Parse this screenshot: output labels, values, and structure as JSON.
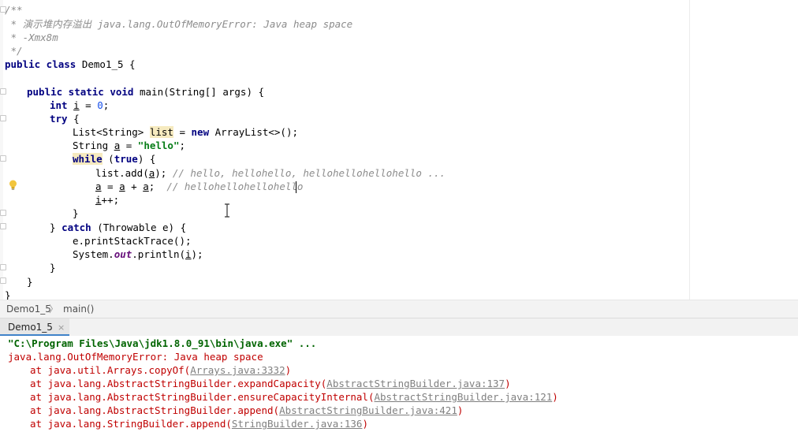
{
  "editor": {
    "lines": [
      {
        "text": "/**"
      },
      {
        "text": " * 演示堆内存溢出 java.lang.OutOfMemoryError: Java heap space"
      },
      {
        "text": " * -Xmx8m"
      },
      {
        "text": " */"
      },
      {
        "kw1": "public class",
        "rest": " Demo1_5 {"
      },
      {
        "kw1": "public static void",
        "rest": " main(String[] args) {"
      },
      {
        "kw1": "int",
        "var": "i",
        "rest": " = ",
        "num": "0",
        "end": ";"
      },
      {
        "kw1": "try",
        "rest": " {"
      },
      {
        "pre": "List<String> ",
        "hl": "list",
        "rest": " = ",
        "kw2": "new",
        "end": " ArrayList<>();"
      },
      {
        "pre": "String ",
        "var": "a",
        "rest": " = ",
        "str": "\"hello\"",
        "end": ";"
      },
      {
        "kw1": "while",
        "rest": " (",
        "kw2": "true",
        "end": ") {"
      },
      {
        "pre": "list.add(",
        "var": "a",
        "rest": "); ",
        "cmt": "// hello, hellohello, hellohellohellohello ..."
      },
      {
        "var": "a",
        "rest": " = ",
        "var2": "a",
        "mid": " + ",
        "var3": "a",
        "end": ";  ",
        "cmt": "// hellohellohellohello"
      },
      {
        "var": "i",
        "rest": "++;"
      },
      {
        "rest": "}"
      },
      {
        "pre": "} ",
        "kw1": "catch",
        "rest": " (Throwable e) {"
      },
      {
        "rest": "e.printStackTrace();"
      },
      {
        "pre": "System.",
        "static": "out",
        "mid": ".println(",
        "var": "i",
        "end": ");"
      },
      {
        "rest": "}"
      },
      {
        "rest": "}"
      },
      {
        "rest": "}"
      }
    ]
  },
  "breadcrumb": {
    "class_name": "Demo1_5",
    "separator": "〉",
    "method_name": "main()"
  },
  "run_panel": {
    "tab_label": "Demo1_5",
    "close_glyph": "×",
    "console": {
      "command": "\"C:\\Program Files\\Java\\jdk1.8.0_91\\bin\\java.exe\" ...",
      "error": "java.lang.OutOfMemoryError: Java heap space",
      "stack": [
        {
          "prefix": "at java.util.Arrays.copyOf(",
          "link": "Arrays.java:3332",
          "suffix": ")"
        },
        {
          "prefix": "at java.lang.AbstractStringBuilder.expandCapacity(",
          "link": "AbstractStringBuilder.java:137",
          "suffix": ")"
        },
        {
          "prefix": "at java.lang.AbstractStringBuilder.ensureCapacityInternal(",
          "link": "AbstractStringBuilder.java:121",
          "suffix": ")"
        },
        {
          "prefix": "at java.lang.AbstractStringBuilder.append(",
          "link": "AbstractStringBuilder.java:421",
          "suffix": ")"
        },
        {
          "prefix": "at java.lang.StringBuilder.append(",
          "link": "StringBuilder.java:136",
          "suffix": ")"
        }
      ]
    }
  },
  "colors": {
    "keyword": "#000080",
    "string": "#067d17",
    "comment": "#8c8c8c",
    "error": "#c00000",
    "usage_highlight": "#f6eabf",
    "console_command": "#006400"
  },
  "icons": {
    "gutter": "lightbulb-icon",
    "cursor": "text-cursor-icon"
  }
}
